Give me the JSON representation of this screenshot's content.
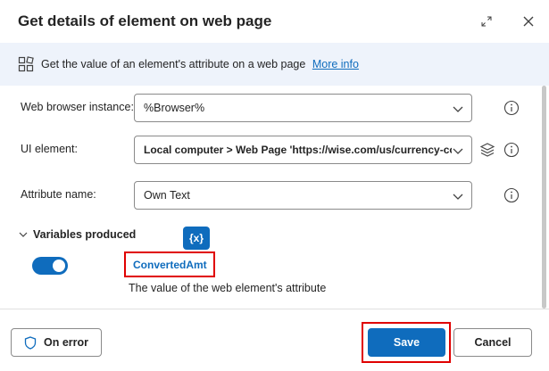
{
  "dialog": {
    "title": "Get details of element on web page"
  },
  "info": {
    "text": "Get the value of an element's attribute on a web page",
    "link": "More info"
  },
  "fields": {
    "browser": {
      "label": "Web browser instance:",
      "value": "%Browser%"
    },
    "ui_element": {
      "label": "UI element:",
      "value": "Local computer > Web Page 'https://wise.com/us/currency-con"
    },
    "attribute": {
      "label": "Attribute name:",
      "value": "Own Text"
    }
  },
  "variables": {
    "header": "Variables produced",
    "badge": "{x}",
    "name": "ConvertedAmt",
    "description": "The value of the web element's attribute",
    "enabled": true
  },
  "footer": {
    "on_error": "On error",
    "save": "Save",
    "cancel": "Cancel"
  },
  "colors": {
    "accent": "#0f6cbd",
    "highlight": "#e00000",
    "banner": "#eef3fb"
  }
}
